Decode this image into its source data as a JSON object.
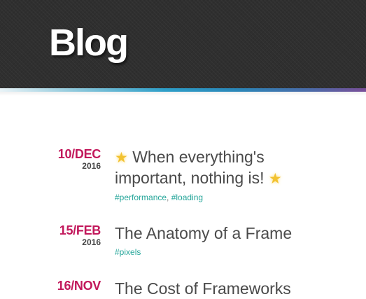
{
  "header": {
    "title": "Blog"
  },
  "posts": [
    {
      "date": "10/DEC",
      "year": "2016",
      "title_line1": "When everything's",
      "title_line2": "important, nothing is!",
      "star_icon": "sparkle-star",
      "tags": [
        "#performance",
        "#loading"
      ]
    },
    {
      "date": "15/FEB",
      "year": "2016",
      "title": "The Anatomy of a Frame",
      "tags": [
        "#pixels"
      ]
    },
    {
      "date": "16/NOV",
      "title": "The Cost of Frameworks"
    }
  ],
  "colors": {
    "header_bg": "#2f2f2f",
    "date_accent": "#c2185b",
    "tag_accent": "#26a69a",
    "title_text": "#4a4a4a"
  }
}
